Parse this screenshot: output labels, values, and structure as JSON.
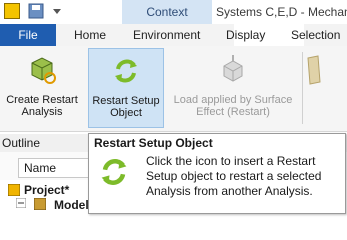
{
  "titlebar": {
    "context_tab": "Context",
    "window_title": "Systems C,E,D - Mechanic"
  },
  "tabs": {
    "file": "File",
    "home": "Home",
    "environment": "Environment",
    "display": "Display",
    "selection": "Selection"
  },
  "ribbon": {
    "create_restart": "Create Restart\nAnalysis",
    "restart_setup": "Restart Setup\nObject",
    "load_applied": "Load applied by Surface\nEffect (Restart)"
  },
  "outline": {
    "title": "Outline",
    "name_label": "Name",
    "project": "Project*",
    "model": "Model"
  },
  "tooltip": {
    "title": "Restart Setup Object",
    "body": "Click the icon to insert a Restart Setup object to restart a selected Analysis from another Analysis."
  },
  "colors": {
    "file_tab": "#1f5db0",
    "context_bg": "#d4e4f4",
    "active_button_bg": "#cfe3f5",
    "green_arrows": "#7dbb2a"
  }
}
